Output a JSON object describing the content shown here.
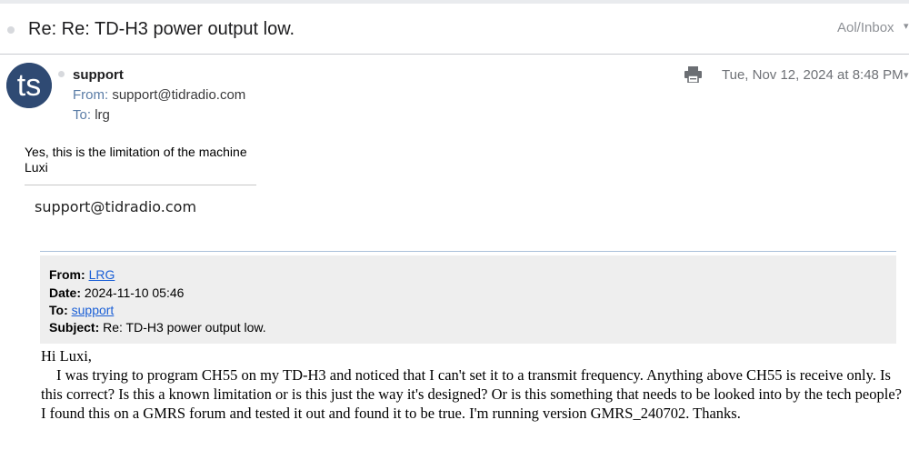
{
  "subject": "Re: Re: TD-H3 power output low.",
  "folder": "Aol/Inbox",
  "avatar_initials": "ts",
  "sender": {
    "name": "support",
    "from_label": "From:",
    "from_value": "support@tidradio.com",
    "to_label": "To:",
    "to_value": "lrg"
  },
  "date": "Tue, Nov 12, 2024 at 8:48 PM",
  "reply": {
    "line1": "Yes, this is the limitation of the machine",
    "line2": "Luxi",
    "signature": "support@tidradio.com"
  },
  "quoted_header": {
    "from_label": "From:",
    "from_value": "LRG",
    "date_label": "Date:",
    "date_value": "2024-11-10 05:46",
    "to_label": "To:",
    "to_value": "support",
    "subject_label": "Subject:",
    "subject_value": "Re: TD-H3 power output low."
  },
  "quoted_body": {
    "greeting": "Hi Luxi,",
    "paragraph": "I was trying to program CH55 on my TD-H3 and noticed that I can't set it to a transmit frequency.  Anything above CH55 is receive only.  Is this correct?  Is this a known limitation or is this just the way it's designed?  Or is this something that needs to be looked into by the tech people?  I found this on a GMRS forum and tested it out and found it to be true.  I'm running version GMRS_240702.  Thanks."
  },
  "colors": {
    "avatar_bg": "#2f4a73",
    "link": "#1a5fd6",
    "label_blue": "#5a7ca6",
    "quote_bg": "#eeeeee"
  },
  "icons": [
    "print-icon",
    "chevron-down-icon"
  ]
}
